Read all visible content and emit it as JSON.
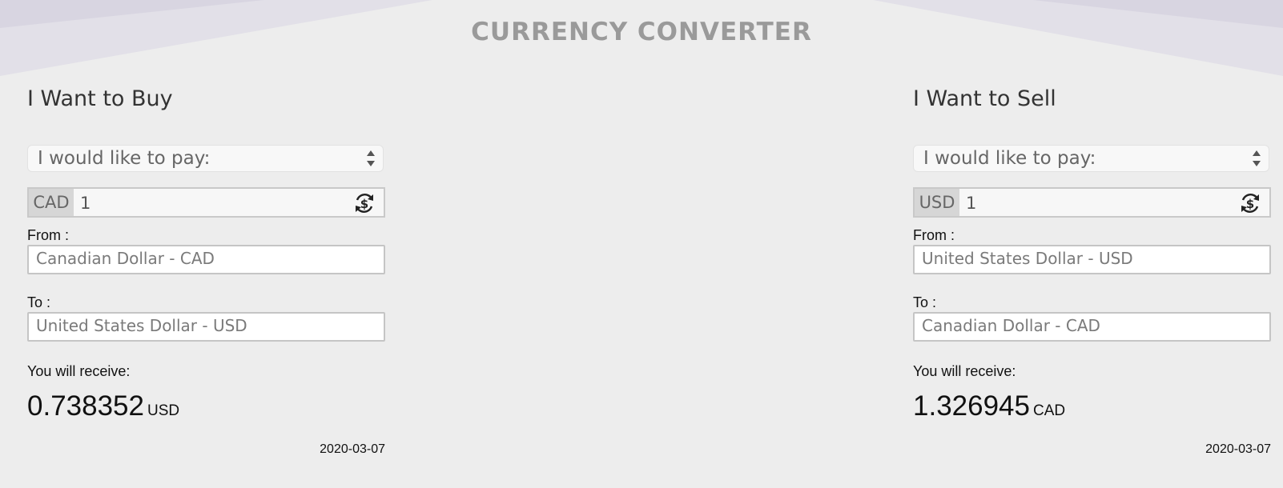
{
  "title": "CURRENCY CONVERTER",
  "colors": {
    "background": "#ededed",
    "title": "#9a9a9a",
    "decoration": "#dcd9e4"
  },
  "buy": {
    "heading": "I Want to Buy",
    "select_label": "I would like to pay:",
    "amount_currency": "CAD",
    "amount_value": "1",
    "from_label": "From :",
    "from_value": "Canadian Dollar - CAD",
    "to_label": "To :",
    "to_value": "United States Dollar - USD",
    "receive_label": "You will receive:",
    "result_value": "0.738352",
    "result_unit": "USD",
    "date": "2020-03-07"
  },
  "sell": {
    "heading": "I Want to Sell",
    "select_label": "I would like to pay:",
    "amount_currency": "USD",
    "amount_value": "1",
    "from_label": "From :",
    "from_value": "United States Dollar - USD",
    "to_label": "To :",
    "to_value": "Canadian Dollar - CAD",
    "receive_label": "You will receive:",
    "result_value": "1.326945",
    "result_unit": "CAD",
    "date": "2020-03-07"
  },
  "icons": {
    "swap": "currency-exchange-icon",
    "select_arrows": "up-down-arrows-icon"
  }
}
